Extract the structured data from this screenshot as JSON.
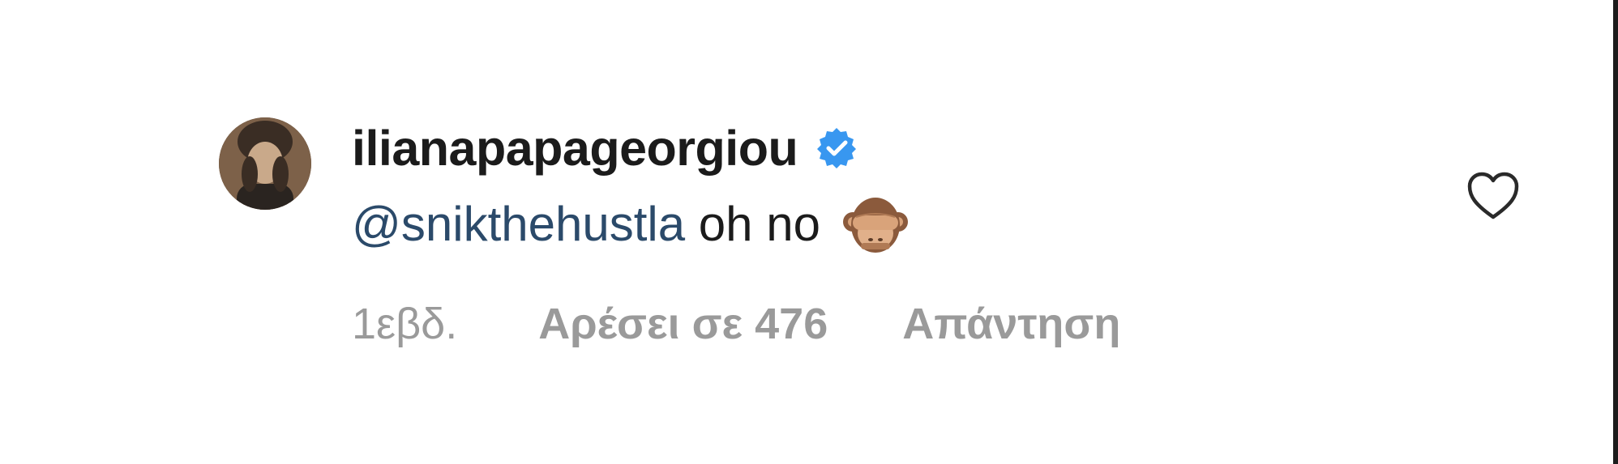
{
  "comment": {
    "username": "ilianapapageorgiou",
    "verified": true,
    "mention": "@snikthehustla",
    "text": "oh no",
    "emoji": "see-no-evil-monkey-icon",
    "time": "1εβδ.",
    "likes_label": "Αρέσει σε 476",
    "reply_label": "Απάντηση"
  },
  "colors": {
    "text": "#1b1b1b",
    "mention": "#2b4a6a",
    "meta": "#9a9a9a",
    "verified": "#3897f0"
  }
}
